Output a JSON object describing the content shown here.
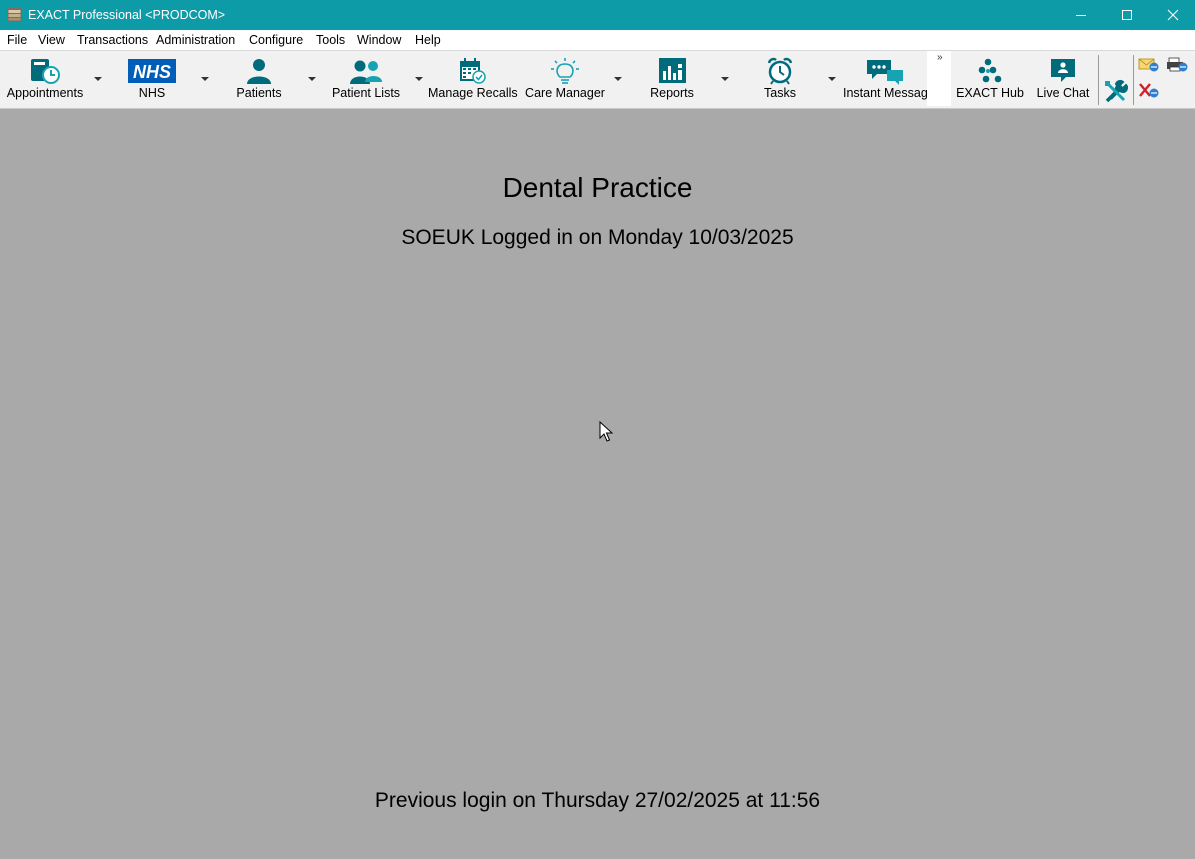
{
  "window": {
    "title": "EXACT Professional <PRODCOM>",
    "icon": "app-icon",
    "controls": [
      "minimize-icon",
      "maximize-icon",
      "close-icon"
    ]
  },
  "menu": {
    "items": [
      "File",
      "View",
      "Transactions",
      "Administration",
      "Configure",
      "Tools",
      "Window",
      "Help"
    ]
  },
  "toolbar": {
    "buttons": [
      {
        "label": "Appointments",
        "icon": "appointment-book-icon"
      },
      {
        "label": "NHS",
        "icon": "nhs-logo-icon",
        "logo_text": "NHS"
      },
      {
        "label": "Patients",
        "icon": "patient-icon"
      },
      {
        "label": "Patient Lists",
        "icon": "patient-list-icon"
      },
      {
        "label": "Manage Recalls",
        "icon": "calendar-check-icon"
      },
      {
        "label": "Care Manager",
        "icon": "lightbulb-icon"
      },
      {
        "label": "Reports",
        "icon": "bar-chart-icon"
      },
      {
        "label": "Tasks",
        "icon": "alarm-clock-icon"
      },
      {
        "label": "Instant Message",
        "icon": "chat-bubbles-icon"
      },
      {
        "label": "EXACT Hub",
        "icon": "hub-dots-icon"
      },
      {
        "label": "Live Chat",
        "icon": "live-chat-icon"
      }
    ],
    "overflow_icon": "chevron-double-right-icon",
    "extra_icons": [
      "tools-icon",
      "email-icon",
      "printer-icon",
      "close-red-icon"
    ]
  },
  "content": {
    "practice_name": "Dental Practice",
    "login_line": "SOEUK Logged in on Monday 10/03/2025",
    "previous_login": "Previous login on Thursday 27/02/2025 at 11:56"
  },
  "colors": {
    "titlebar": "#0e9ba8",
    "icon_teal": "#006b7a",
    "icon_light_teal": "#16a4b4",
    "background": "#a8a9a8",
    "nhs_blue": "#005eb8"
  }
}
